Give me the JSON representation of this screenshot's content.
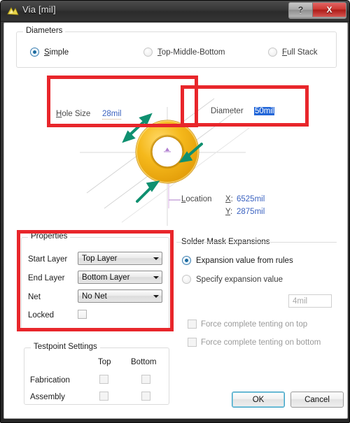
{
  "window": {
    "title": "Via [mil]",
    "icon": "via-icon",
    "help_label": "?",
    "close_label": "X"
  },
  "diameters": {
    "group_title": "Diameters",
    "options": [
      {
        "label": "Simple",
        "accel": "S",
        "selected": true
      },
      {
        "label": "Top-Middle-Bottom",
        "accel": "T",
        "selected": false
      },
      {
        "label": "Full Stack",
        "accel": "F",
        "selected": false
      }
    ]
  },
  "preview": {
    "hole_size_label": "Hole Size",
    "hole_size_value": "28mil",
    "diameter_label": "Diameter",
    "diameter_value": "50mil",
    "location_label": "Location",
    "x_label": "X:",
    "x_value": "6525mil",
    "y_label": "Y:",
    "y_value": "2875mil",
    "via_color_outer": "#f0b21a",
    "via_color_inner": "#e09a10",
    "arrow_color": "#0f9070",
    "annotation_color": "#e8262b"
  },
  "properties": {
    "group_title": "Properties",
    "rows": [
      {
        "label": "Start Layer",
        "value": "Top Layer"
      },
      {
        "label": "End Layer",
        "value": "Bottom Layer"
      },
      {
        "label": "Net",
        "value": "No Net"
      }
    ],
    "locked_label": "Locked",
    "locked_checked": false
  },
  "solder_mask": {
    "group_title": "Solder Mask Expansions",
    "from_rules_label": "Expansion value from rules",
    "from_rules_selected": true,
    "specify_label": "Specify expansion value",
    "specify_selected": false,
    "specify_value": "4mil",
    "tenting_top_label": "Force complete tenting on top",
    "tenting_top_checked": false,
    "tenting_bottom_label": "Force complete tenting on bottom",
    "tenting_bottom_checked": false
  },
  "testpoint": {
    "group_title": "Testpoint Settings",
    "col_top": "Top",
    "col_bottom": "Bottom",
    "rows": [
      {
        "label": "Fabrication",
        "top_checked": false,
        "bottom_checked": false
      },
      {
        "label": "Assembly",
        "top_checked": false,
        "bottom_checked": false
      }
    ]
  },
  "footer": {
    "ok_label": "OK",
    "cancel_label": "Cancel"
  }
}
